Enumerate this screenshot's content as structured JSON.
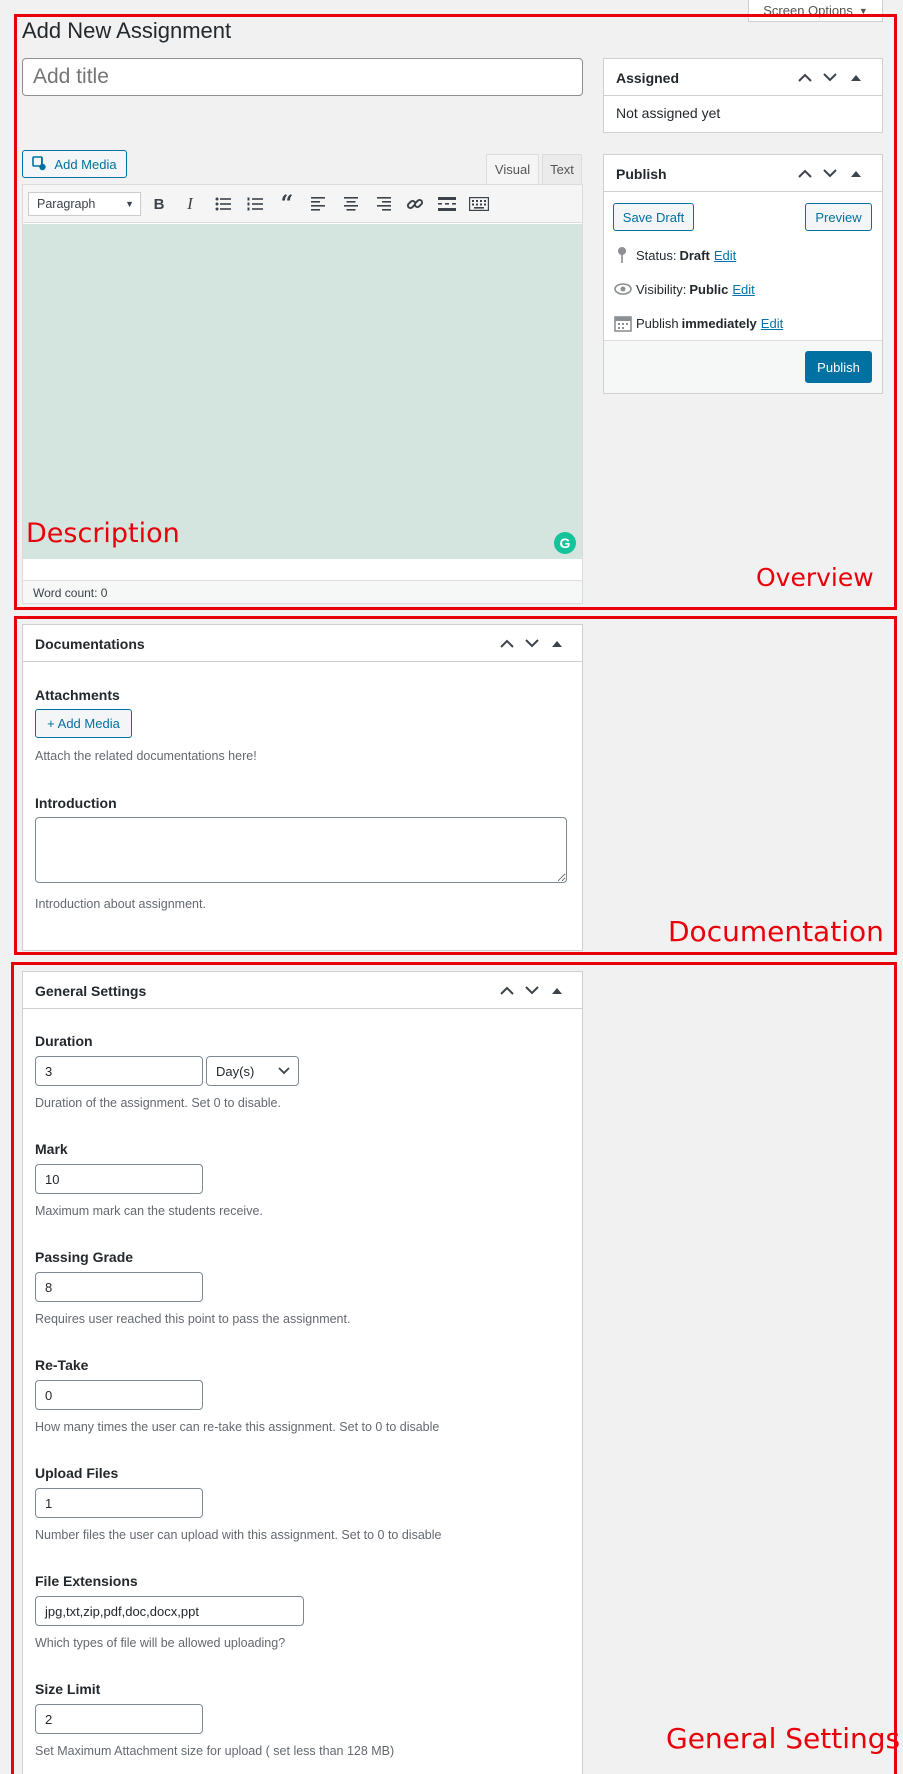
{
  "screen_options": "Screen Options",
  "page_title": "Add New Assignment",
  "title_placeholder": "Add title",
  "editor": {
    "add_media": "Add Media",
    "tab_visual": "Visual",
    "tab_text": "Text",
    "format_select": "Paragraph",
    "word_count": "Word count: 0"
  },
  "assigned": {
    "title": "Assigned",
    "body": "Not assigned yet"
  },
  "publish": {
    "title": "Publish",
    "save_draft": "Save Draft",
    "preview": "Preview",
    "status_label": "Status: ",
    "status_value": "Draft",
    "visibility_label": "Visibility: ",
    "visibility_value": "Public",
    "schedule_label": "Publish ",
    "schedule_value": "immediately",
    "edit": "Edit",
    "publish_button": "Publish"
  },
  "documentations": {
    "title": "Documentations",
    "attachments_label": "Attachments",
    "add_media": "+ Add Media",
    "attachments_desc": "Attach the related documentations here!",
    "introduction_label": "Introduction",
    "introduction_value": "",
    "introduction_desc": "Introduction about assignment."
  },
  "general_settings": {
    "title": "General Settings",
    "duration_label": "Duration",
    "duration_value": "3",
    "duration_unit": "Day(s)",
    "duration_desc": "Duration of the assignment. Set 0 to disable.",
    "mark_label": "Mark",
    "mark_value": "10",
    "mark_desc": "Maximum mark can the students receive.",
    "passing_label": "Passing Grade",
    "passing_value": "8",
    "passing_desc": "Requires user reached this point to pass the assignment.",
    "retake_label": "Re-Take",
    "retake_value": "0",
    "retake_desc": "How many times the user can re-take this assignment. Set to 0 to disable",
    "upload_label": "Upload Files",
    "upload_value": "1",
    "upload_desc": "Number files the user can upload with this assignment. Set to 0 to disable",
    "ext_label": "File Extensions",
    "ext_value": "jpg,txt,zip,pdf,doc,docx,ppt",
    "ext_desc": "Which types of file will be allowed uploading?",
    "size_label": "Size Limit",
    "size_value": "2",
    "size_desc": "Set Maximum Attachment size for upload ( set less than 128 MB)"
  },
  "annotations": {
    "description": "Description",
    "overview": "Overview",
    "documentation": "Documentation",
    "general_settings": "General Settings"
  },
  "colors": {
    "accent": "#0071a1",
    "annotation": "#e8000b",
    "editor_bg": "#d4e5e0",
    "grammarly": "#15c39a"
  }
}
